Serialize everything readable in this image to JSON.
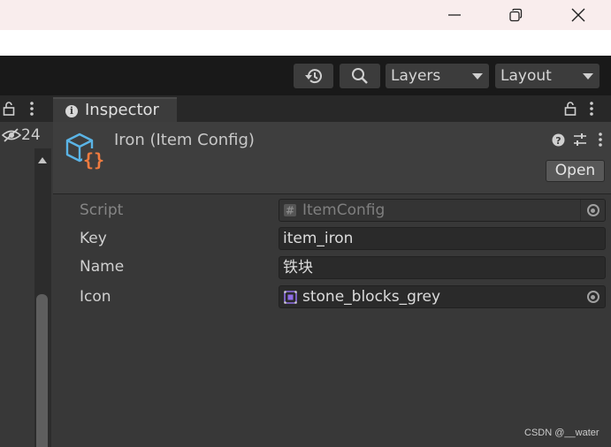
{
  "window": {
    "minimize_icon": "minimize-icon",
    "maximize_icon": "restore-icon",
    "close_icon": "close-icon"
  },
  "toolbar": {
    "history_icon": "history-icon",
    "search_icon": "search-icon",
    "layers_label": "Layers",
    "layout_label": "Layout"
  },
  "left_panel": {
    "hidden_count": "24"
  },
  "inspector": {
    "tab_label": "Inspector",
    "asset_title": "Iron (Item Config)",
    "open_label": "Open",
    "properties": {
      "script_label": "Script",
      "script_value": "ItemConfig",
      "key_label": "Key",
      "key_value": "item_iron",
      "name_label": "Name",
      "name_value": "铁块",
      "icon_label": "Icon",
      "icon_value": "stone_blocks_grey"
    }
  },
  "watermark": "CSDN @__water",
  "colors": {
    "editor_bg": "#383838",
    "toolbar_bg": "#191919",
    "asset_icon_blue": "#5ab4e6",
    "asset_icon_orange": "#f07b3f",
    "sprite_icon_purple": "#8f6ee6"
  }
}
